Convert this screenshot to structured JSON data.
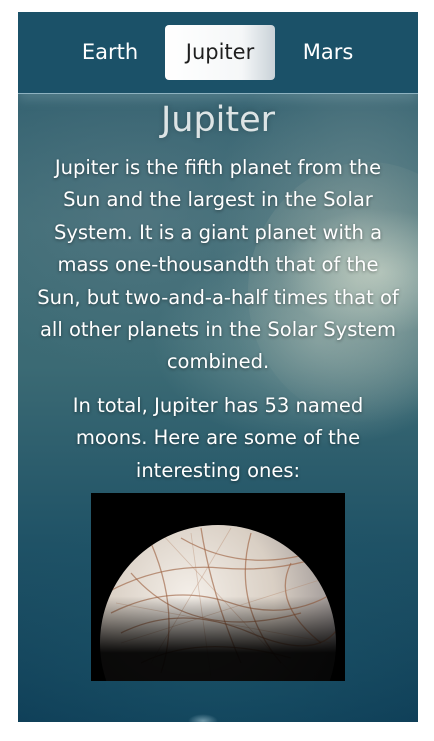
{
  "nav": {
    "tabs": [
      {
        "label": "Earth",
        "selected": false
      },
      {
        "label": "Jupiter",
        "selected": true
      },
      {
        "label": "Mars",
        "selected": false
      }
    ]
  },
  "main": {
    "title": "Jupiter",
    "description": "Jupiter is the fifth planet from the Sun and the largest in the Solar System. It is a giant planet with a mass one-thousandth that of the Sun, but two-and-a-half times that of all other planets in the Solar System combined.",
    "moons_intro": "In total, Jupiter has 53 named moons. Here are some of the interesting ones:"
  },
  "colors": {
    "nav_background": "#1b5168",
    "selected_tab_background": "#ffffff",
    "selected_tab_text": "#1f1f1f",
    "text": "#ffffff"
  }
}
